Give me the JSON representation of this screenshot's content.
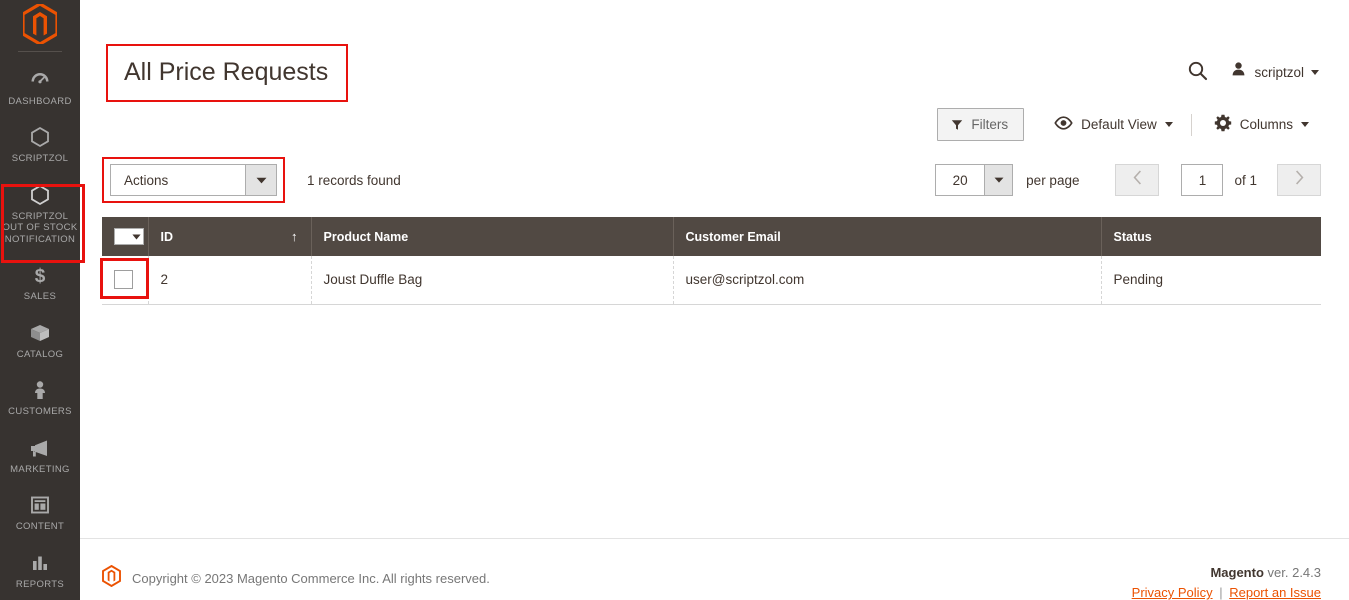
{
  "sidebar": {
    "logo_icon": "magento-logo-icon",
    "items": [
      {
        "label": "Dashboard",
        "icon": "dashboard-gauge-icon",
        "active": false
      },
      {
        "label": "Scriptzol",
        "icon": "hexagon-icon",
        "active": false
      },
      {
        "label": "Scriptzol Out of Stock Notification",
        "icon": "hexagon-icon",
        "active": true
      },
      {
        "label": "Sales",
        "icon": "dollar-icon",
        "active": false
      },
      {
        "label": "Catalog",
        "icon": "box-icon",
        "active": false
      },
      {
        "label": "Customers",
        "icon": "person-icon",
        "active": false
      },
      {
        "label": "Marketing",
        "icon": "megaphone-icon",
        "active": false
      },
      {
        "label": "Content",
        "icon": "layout-icon",
        "active": false
      },
      {
        "label": "Reports",
        "icon": "bar-chart-icon",
        "active": false
      }
    ]
  },
  "header": {
    "page_title": "All Price Requests",
    "search_icon": "search-icon",
    "user_icon": "user-avatar-icon",
    "user_name": "scriptzol"
  },
  "toolbar": {
    "filters_label": "Filters",
    "filters_icon": "funnel-icon",
    "view_label": "Default View",
    "view_icon": "eye-icon",
    "columns_label": "Columns",
    "columns_icon": "gear-icon"
  },
  "grid_controls": {
    "actions_label": "Actions",
    "records_found": "1 records found",
    "per_page_value": "20",
    "per_page_label": "per page",
    "prev_icon": "chevron-left-icon",
    "next_icon": "chevron-right-icon",
    "current_page": "1",
    "of_pages": "of 1"
  },
  "table": {
    "columns": [
      {
        "key": "checkbox",
        "label": ""
      },
      {
        "key": "id",
        "label": "ID",
        "sort": "asc"
      },
      {
        "key": "product_name",
        "label": "Product Name"
      },
      {
        "key": "customer_email",
        "label": "Customer Email"
      },
      {
        "key": "status",
        "label": "Status"
      }
    ],
    "rows": [
      {
        "id": "2",
        "product_name": "Joust Duffle Bag",
        "customer_email": "user@scriptzol.com",
        "status": "Pending"
      }
    ]
  },
  "footer": {
    "copyright": "Copyright © 2023 Magento Commerce Inc. All rights reserved.",
    "brand": "Magento",
    "version": " ver. 2.4.3",
    "privacy_label": "Privacy Policy",
    "divider": "|",
    "report_label": "Report an Issue"
  },
  "colors": {
    "sidebar_bg": "#373330",
    "accent_orange": "#eb5202",
    "table_header_bg": "#514943",
    "annotation_red": "#e8120e"
  }
}
